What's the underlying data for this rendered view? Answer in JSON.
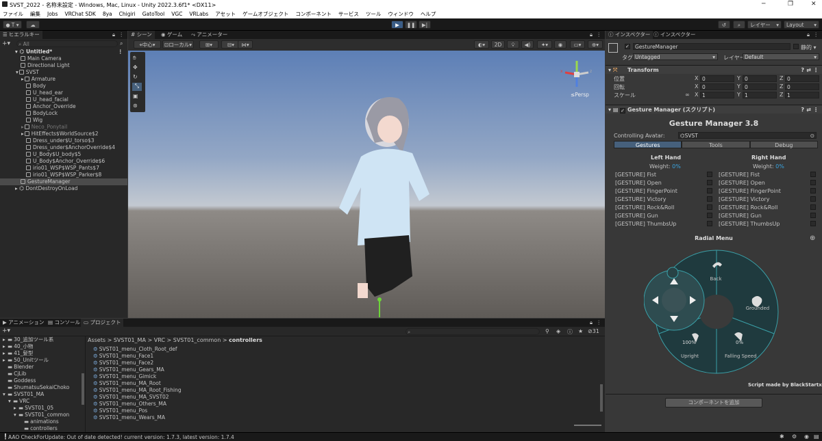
{
  "window": {
    "title": "SVST_2022 - 名称未設定 - Windows, Mac, Linux - Unity 2022.3.6f1* <DX11>",
    "min": "─",
    "max": "❐",
    "close": "✕"
  },
  "menu": [
    "ファイル",
    "編集",
    "Jobs",
    "VRChat SDK",
    "8ya",
    "Chigiri",
    "GatoTool",
    "VGC",
    "VRLabs",
    "アセット",
    "ゲームオブジェクト",
    "コンポーネント",
    "サービス",
    "ツール",
    "ウィンドウ",
    "ヘルプ"
  ],
  "toolbar": {
    "account": "T",
    "layer_label": "レイヤー",
    "layout_label": "Layout"
  },
  "hierarchy": {
    "tab": "ヒエラルキー",
    "search": "All",
    "scene": "Untitled*",
    "items": [
      {
        "label": "Main Camera",
        "d": 1
      },
      {
        "label": "Directional Light",
        "d": 1
      },
      {
        "label": "SVST",
        "d": 1
      },
      {
        "label": "Armature",
        "d": 2
      },
      {
        "label": "Body",
        "d": 2
      },
      {
        "label": "U_head_ear",
        "d": 2
      },
      {
        "label": "U_head_facial",
        "d": 2
      },
      {
        "label": "Anchor_Override",
        "d": 2
      },
      {
        "label": "BodyLock",
        "d": 2
      },
      {
        "label": "Wig",
        "d": 2
      },
      {
        "label": "Neco_Ponytail",
        "d": 2,
        "dim": true
      },
      {
        "label": "HitEffects$WorldSource$2",
        "d": 2
      },
      {
        "label": "Dress_under$U_torso$3",
        "d": 2
      },
      {
        "label": "Dress_under$AnchorOverride$4",
        "d": 2
      },
      {
        "label": "U_Body$U_body$5",
        "d": 2
      },
      {
        "label": "U_Body$Anchor_Override$6",
        "d": 2
      },
      {
        "label": "irio01_WSP$WSP_Pants$7",
        "d": 2
      },
      {
        "label": "irio01_WSP$WSP_Parker$8",
        "d": 2
      },
      {
        "label": "GestureManager",
        "d": 1,
        "sel": true
      }
    ],
    "ddol": "DontDestroyOnLoad"
  },
  "scene": {
    "tabs": [
      "シーン",
      "ゲーム",
      "アニメーター"
    ],
    "pivot": "中心",
    "space": "ローカル",
    "mode2d": "2D",
    "persp": "≤Persp"
  },
  "bottom": {
    "tabs": [
      "アニメーション",
      "コンソール",
      "プロジェクト"
    ],
    "count": "31",
    "folders": [
      {
        "label": "30_追加ツール系",
        "d": 1
      },
      {
        "label": "40_小物",
        "d": 1
      },
      {
        "label": "41_髪型",
        "d": 1
      },
      {
        "label": "50_Unitツール",
        "d": 1
      },
      {
        "label": "Blender",
        "d": 1
      },
      {
        "label": "CjLib",
        "d": 1
      },
      {
        "label": "Goddess",
        "d": 1
      },
      {
        "label": "ShumatsuSekaiChoko",
        "d": 1
      },
      {
        "label": "SVST01_MA",
        "d": 1
      },
      {
        "label": "VRC",
        "d": 2
      },
      {
        "label": "SVST01_05",
        "d": 3
      },
      {
        "label": "SVST01_common",
        "d": 3
      },
      {
        "label": "animations",
        "d": 4
      },
      {
        "label": "controllers",
        "d": 4
      }
    ],
    "breadcrumb": [
      "Assets",
      "SVST01_MA",
      "VRC",
      "SVST01_common",
      "controllers"
    ],
    "files": [
      "SVST01_menu_Cloth_Root_def",
      "SVST01_menu_Face1",
      "SVST01_menu_Face2",
      "SVST01_menu_Gears_MA",
      "SVST01_menu_Gimick",
      "SVST01_menu_MA_Root",
      "SVST01_menu_MA_Root_Fishing",
      "SVST01_menu_MA_SVST02",
      "SVST01_menu_Others_MA",
      "SVST01_menu_Pos",
      "SVST01_menu_Wears_MA"
    ]
  },
  "inspector": {
    "tabs": [
      "インスペクター",
      "インスペクター"
    ],
    "object_name": "GestureManager",
    "static": "静的",
    "tag_label": "タグ",
    "tag": "Untagged",
    "layer_label": "レイヤー",
    "layer": "Default",
    "transform": {
      "title": "Transform",
      "rows": [
        {
          "label": "位置",
          "x": "0",
          "y": "0",
          "z": "0"
        },
        {
          "label": "回転",
          "x": "0",
          "y": "0",
          "z": "0"
        },
        {
          "label": "スケール",
          "x": "1",
          "y": "1",
          "z": "1"
        }
      ]
    },
    "gm": {
      "title": "Gesture Manager (スクリプト)",
      "heading": "Gesture Manager 3.8",
      "avatar_label": "Controlling Avatar:",
      "avatar": "SVST",
      "tabs": [
        "Gestures",
        "Tools",
        "Debug"
      ],
      "left": "Left Hand",
      "right": "Right Hand",
      "weight": "Weight:",
      "weight_val": "0%",
      "gestures": [
        "[GESTURE] Fist",
        "[GESTURE] Open",
        "[GESTURE] FingerPoint",
        "[GESTURE] Victory",
        "[GESTURE] Rock&Roll",
        "[GESTURE] Gun",
        "[GESTURE] ThumbsUp"
      ],
      "radial_title": "Radial Menu",
      "back": "Back",
      "grounded": "Grounded",
      "upright": "Upright",
      "upright_val": "100%",
      "falling": "Falling Speed",
      "falling_val": "0%",
      "credit": "Script made by BlackStartx"
    },
    "add_component": "コンポーネントを追加"
  },
  "status": "AAO CheckForUpdate: Out of date detected! current version: 1.7.3, latest version: 1.7.4",
  "axes": {
    "x": "x",
    "y": "y",
    "z": "z"
  }
}
